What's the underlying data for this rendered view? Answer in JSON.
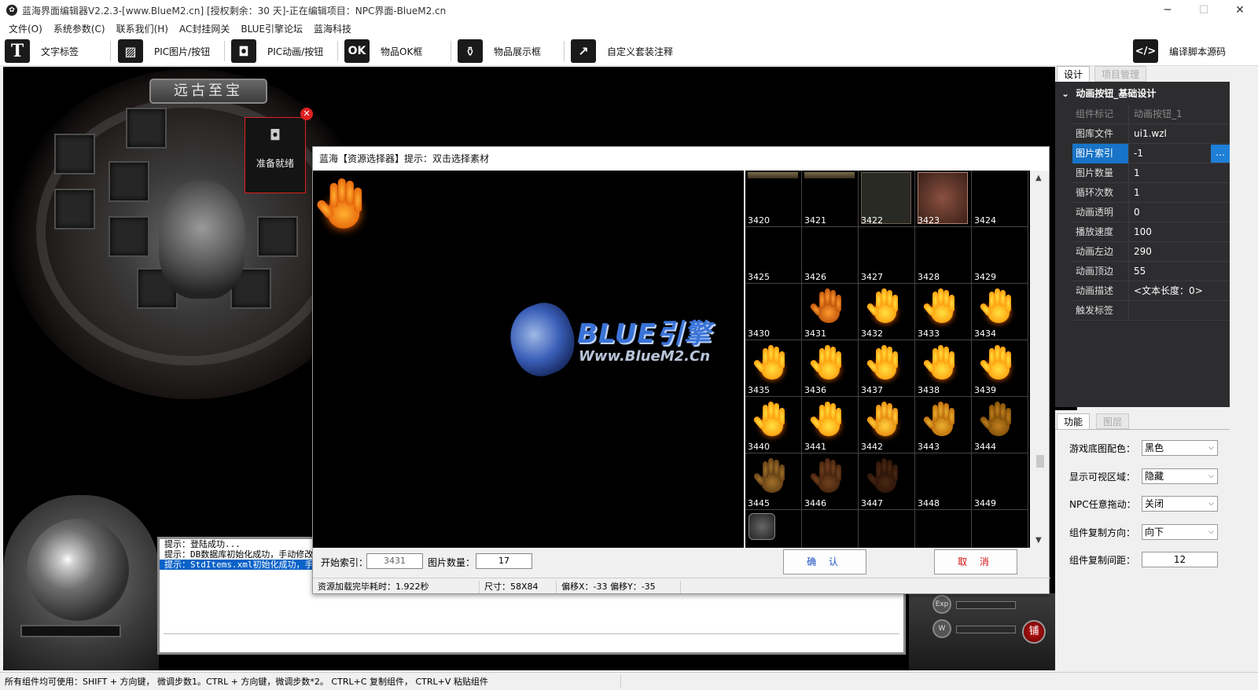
{
  "window": {
    "title": "蓝海界面编辑器V2.2.3-[www.BlueM2.cn] [授权剩余：30 天]-正在编辑项目：NPC界面-BlueM2.cn"
  },
  "menu": [
    "文件(O)",
    "系统参数(C)",
    "联系我们(H)",
    "AC封挂网关",
    "BLUE引擎论坛",
    "蓝海科技"
  ],
  "toolbar": {
    "text_label": "文字标签",
    "pic_button": "PIC图片/按钮",
    "pic_anim": "PIC动画/按钮",
    "ok_icon": "OK",
    "item_ok": "物品OK框",
    "item_show": "物品展示框",
    "custom_note": "自定义套装注释",
    "compile": "编译脚本源码"
  },
  "game": {
    "banner": "远古至宝",
    "anim_label": "准备就绪",
    "chat": [
      "提示：登陆成功...",
      "提示：DB数据库初始化成功，手动修改",
      "提示：StdItems.xml初始化成功，手"
    ],
    "red_btn": "铺"
  },
  "dialog": {
    "title": "蓝海【资源选择器】提示：双击选择素材",
    "start_label": "开始索引：",
    "start_value": "3431",
    "count_label": "图片数量：",
    "count_value": "17",
    "ok": "确 认",
    "cancel": "取 消",
    "status": [
      "资源加载完毕耗时：1.922秒",
      "尺寸：58X84",
      "偏移X：-33 偏移Y：-35"
    ],
    "brand": "BLUE引擎",
    "site": "Www.BlueM2.Cn",
    "cells": [
      "3420",
      "3421",
      "3422",
      "3423",
      "3424",
      "3425",
      "3426",
      "3427",
      "3428",
      "3429",
      "3430",
      "3431",
      "3432",
      "3433",
      "3434",
      "3435",
      "3436",
      "3437",
      "3438",
      "3439",
      "3440",
      "3441",
      "3442",
      "3443",
      "3444",
      "3445",
      "3446",
      "3447",
      "3448",
      "3449"
    ]
  },
  "props": {
    "tab_design": "设计",
    "tab_project": "项目管理",
    "group": "动画按钮_基础设计",
    "rows": [
      {
        "k": "组件标记",
        "v": "动画按钮_1"
      },
      {
        "k": "图库文件",
        "v": "ui1.wzl"
      },
      {
        "k": "图片索引",
        "v": "-1"
      },
      {
        "k": "图片数量",
        "v": "1"
      },
      {
        "k": "循环次数",
        "v": "1"
      },
      {
        "k": "动画透明",
        "v": "0"
      },
      {
        "k": "播放速度",
        "v": "100"
      },
      {
        "k": "动画左边",
        "v": "290"
      },
      {
        "k": "动画顶边",
        "v": "55"
      },
      {
        "k": "动画描述",
        "v": "<文本长度：0>"
      },
      {
        "k": "触发标签",
        "v": ""
      }
    ]
  },
  "func": {
    "tab_func": "功能",
    "tab_layer": "图层",
    "rows": [
      {
        "k": "游戏底图配色：",
        "v": "黑色"
      },
      {
        "k": "显示可视区域：",
        "v": "隐藏"
      },
      {
        "k": "NPC任意拖动：",
        "v": "关闭"
      },
      {
        "k": "组件复制方向：",
        "v": "向下"
      },
      {
        "k": "组件复制间距：",
        "v": "12"
      }
    ]
  },
  "status": "所有组件均可使用：SHIFT + 方向键， 微调步数1。CTRL + 方向键，微调步数*2。 CTRL+C 复制组件， CTRL+V 粘贴组件",
  "colors": {
    "accent": "#1874c8",
    "selection": "#0a62c8",
    "close": "#e02020"
  }
}
